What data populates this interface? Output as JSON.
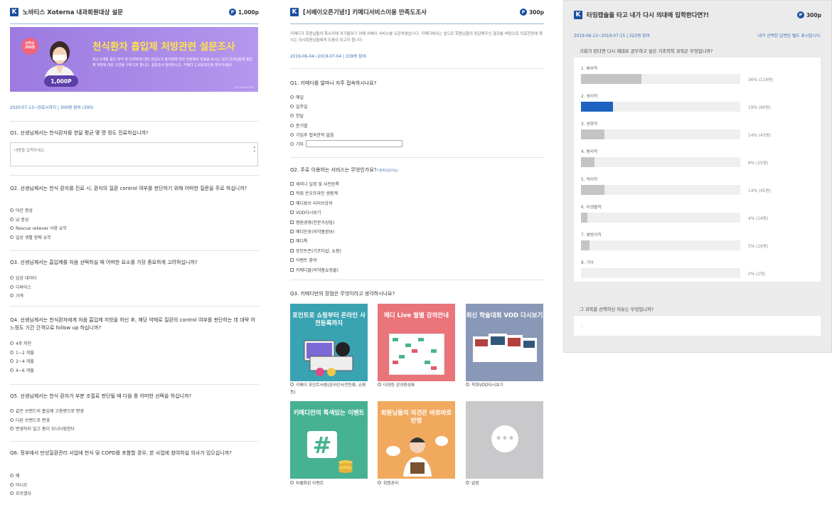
{
  "colors": {
    "brand": "#1a4fa0",
    "link": "#3a6db5",
    "bar": "#c4c4c4",
    "bar_selected": "#1f63c2"
  },
  "panel1": {
    "logo": "K",
    "title": "노바티스 Xoterna 내과회원대상 설문",
    "points": "1,000p",
    "point_icon": "P",
    "banner": {
      "badge": "선착순 300명",
      "headline": "천식환자 흡입제 처방관련 설문조사",
      "desc": "최근 6개월 동안 천식 및 COPD에 대한 관심도가 높아짐에 따라 현장에서 진료를 보시는 내과 선생님들께 흡입제 처방에 대한 고견을 구하고자 합니다. 설문조사 참여하시고, 키메디 1,000포인트 받아가세요!",
      "reward": "1,000P",
      "code": "KIT-000000000"
    },
    "meta": "2020-07-13~완료시까지 | 300명 참여 (300)",
    "q1": "Q1. 선생님께서는 천식환자를 한달 평균 몇 명 정도 진료하십니까?",
    "q1_placeholder": "내용을 입력하세요.",
    "q2": "Q2. 선생님께서는 천식 환자를 진료 시, 환자의 질환 control 여부를 판단하기 위해 어떠한 질문을 주로 하십니까?",
    "q2_options": [
      "야간 증상",
      "낮 증상",
      "Rescue reliever 사용 유무",
      "일상 생활 장애 유무"
    ],
    "q3": "Q3. 선생님께서는 흡입제를 처음 선택하실 때 어떠한 요소를 가장 중요하게 고려하십니까?",
    "q3_options": [
      "임상 데이터",
      "디바이스",
      "가격"
    ],
    "q4": "Q4. 선생님께서는 천식환자에게 처음 흡입제 처방을 하신 후, 해당 약제로 질환의 control 여부를 판단하는 데 대략 어느정도 기간 간격으로 follow up 하십니까?",
    "q4_options": [
      "4주 미만",
      "1~2 개월",
      "2~4 개월",
      "4~6 개월"
    ],
    "q5": "Q5. 선생님께서는 천식 환자가 부분 조절로 판단될 때 다음 중 어떠한 선택을 하십니까?",
    "q5_options": [
      "같은 브랜드의 흡입제 고용량으로 변경",
      "다른 브랜드로 변경",
      "변경하지 않고 좀더 모니터링한다"
    ],
    "q6": "Q6. 정부에서 만성질환관리 사업에 천식 및 COPD를 포함할 경우, 본 사업에 참여하실 의사가 있으십니까?",
    "q6_options": [
      "예",
      "아니오",
      "모르겠다"
    ]
  },
  "panel2": {
    "logo": "K",
    "title": "[서베이오픈기념!] 키메디서비스이용 만족도조사",
    "points": "300p",
    "point_icon": "P",
    "intro": "키메디가 회원님들의 목소리에 귀기울이기 위해 서베이 서비스를 오픈하였습니다. 키메디에서는 앞으로 회원님들의 응답해주신 결과를 바탕으로 의료현장에 계시는 의사회원님들에게 도움이 되고자 합니다.",
    "meta": "2019-06-04~2019-07-04 | 339명 참여",
    "q1": "Q1. 키메디를 얼마나 자주 접속하시나요?",
    "q1_options": [
      "매일",
      "일주일",
      "한달",
      "분기별",
      "가입후 접속한적 없음",
      "기타"
    ],
    "q2": "Q2. 주로 이용하는 서비스는 무엇인가요?",
    "q2_note": "(*중복응답가능)",
    "q2_options": [
      "세미나 일정 및 사전등록",
      "학회 온오프라인 생중계",
      "메디튜브 라이브강의",
      "VOD다시보기",
      "병원경영(전문가상담)",
      "메디인포(의약품정보)",
      "메디톡",
      "포인트존(기프티샵, 쇼핑)",
      "이벤트 참여",
      "키메디몰(의약품쇼핑몰)"
    ],
    "q3": "Q3. 키메디만의 장점은 무엇이라고 생각하시나요?",
    "cards": [
      {
        "text": "포인트로 쇼핑부터 온라인 사전등록까지",
        "label": "키메디 포인트사용(온라인사전등록, 쇼핑 등)"
      },
      {
        "text": "메디 Live 월별 강의안내",
        "label": "다양한 강의편성표"
      },
      {
        "text": "최신 학술대회 VOD 다시보기",
        "label": "학회VOD다시보기"
      },
      {
        "text": "키메디만의 특색있는 이벤트",
        "label": "차별화된 이벤트"
      },
      {
        "text": "회원님들의 의견은 바로바로 반영",
        "label": "회원관리"
      },
      {
        "text": "",
        "label": "없음"
      }
    ]
  },
  "panel3": {
    "logo": "K",
    "title": "타임캡슐을 타고 내가 다시 의대에 입학한다면?!",
    "points": "300p",
    "point_icon": "P",
    "meta": "2019-06-13~2019-07-15 | 222명 참여",
    "meta_right": "내가 선택한 답변은 별도 표시됩니다.",
    "q1": "기회가 된다면 다시 제대로 공부하고 싶은 기초의학 과목은 무엇입니까?",
    "results": [
      {
        "label": "1. 해부학",
        "fraction": 0.36,
        "text": "36% (114명)",
        "selected": false
      },
      {
        "label": "2. 생리학",
        "fraction": 0.19,
        "text": "19% (60명)",
        "selected": true
      },
      {
        "label": "3. 생화학",
        "fraction": 0.14,
        "text": "14% (43명)",
        "selected": false
      },
      {
        "label": "4. 병리학",
        "fraction": 0.08,
        "text": "8% (25명)",
        "selected": false
      },
      {
        "label": "5. 약리학",
        "fraction": 0.14,
        "text": "14% (45명)",
        "selected": false
      },
      {
        "label": "6. 미생물학",
        "fraction": 0.04,
        "text": "4% (14명)",
        "selected": false
      },
      {
        "label": "7. 예방의학",
        "fraction": 0.05,
        "text": "5% (16명)",
        "selected": false
      },
      {
        "label": "8. 기타",
        "fraction": 0.0,
        "text": "0% (1명)",
        "selected": false
      }
    ],
    "q2": "그 과목을 선택하신 이유는 무엇입니까?",
    "q2_answer": "-"
  }
}
